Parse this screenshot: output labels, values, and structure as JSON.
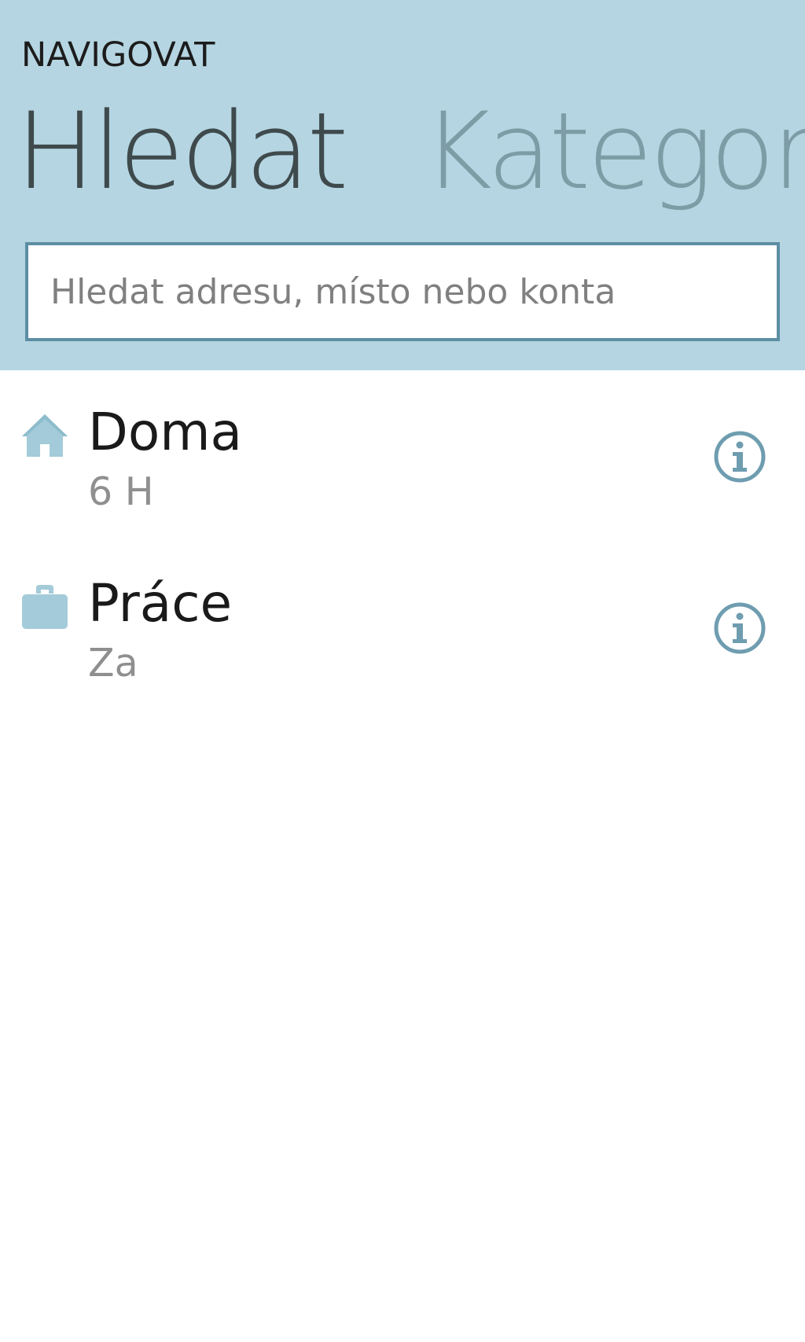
{
  "header": {
    "app_title": "NAVIGOVAT",
    "tabs": [
      {
        "label": "Hledat",
        "active": true
      },
      {
        "label": "Kategorie",
        "active": false
      }
    ],
    "search": {
      "placeholder": "Hledat adresu, místo nebo konta",
      "value": ""
    }
  },
  "places": [
    {
      "icon": "home-icon",
      "title": "Doma",
      "subtitle": "6 H"
    },
    {
      "icon": "briefcase-icon",
      "title": "Práce",
      "subtitle": "Za"
    }
  ],
  "colors": {
    "header_bg": "#b5d5e2",
    "accent": "#6f9db0",
    "active_tab": "#3f4a4d",
    "inactive_tab": "#7e9ca5"
  }
}
